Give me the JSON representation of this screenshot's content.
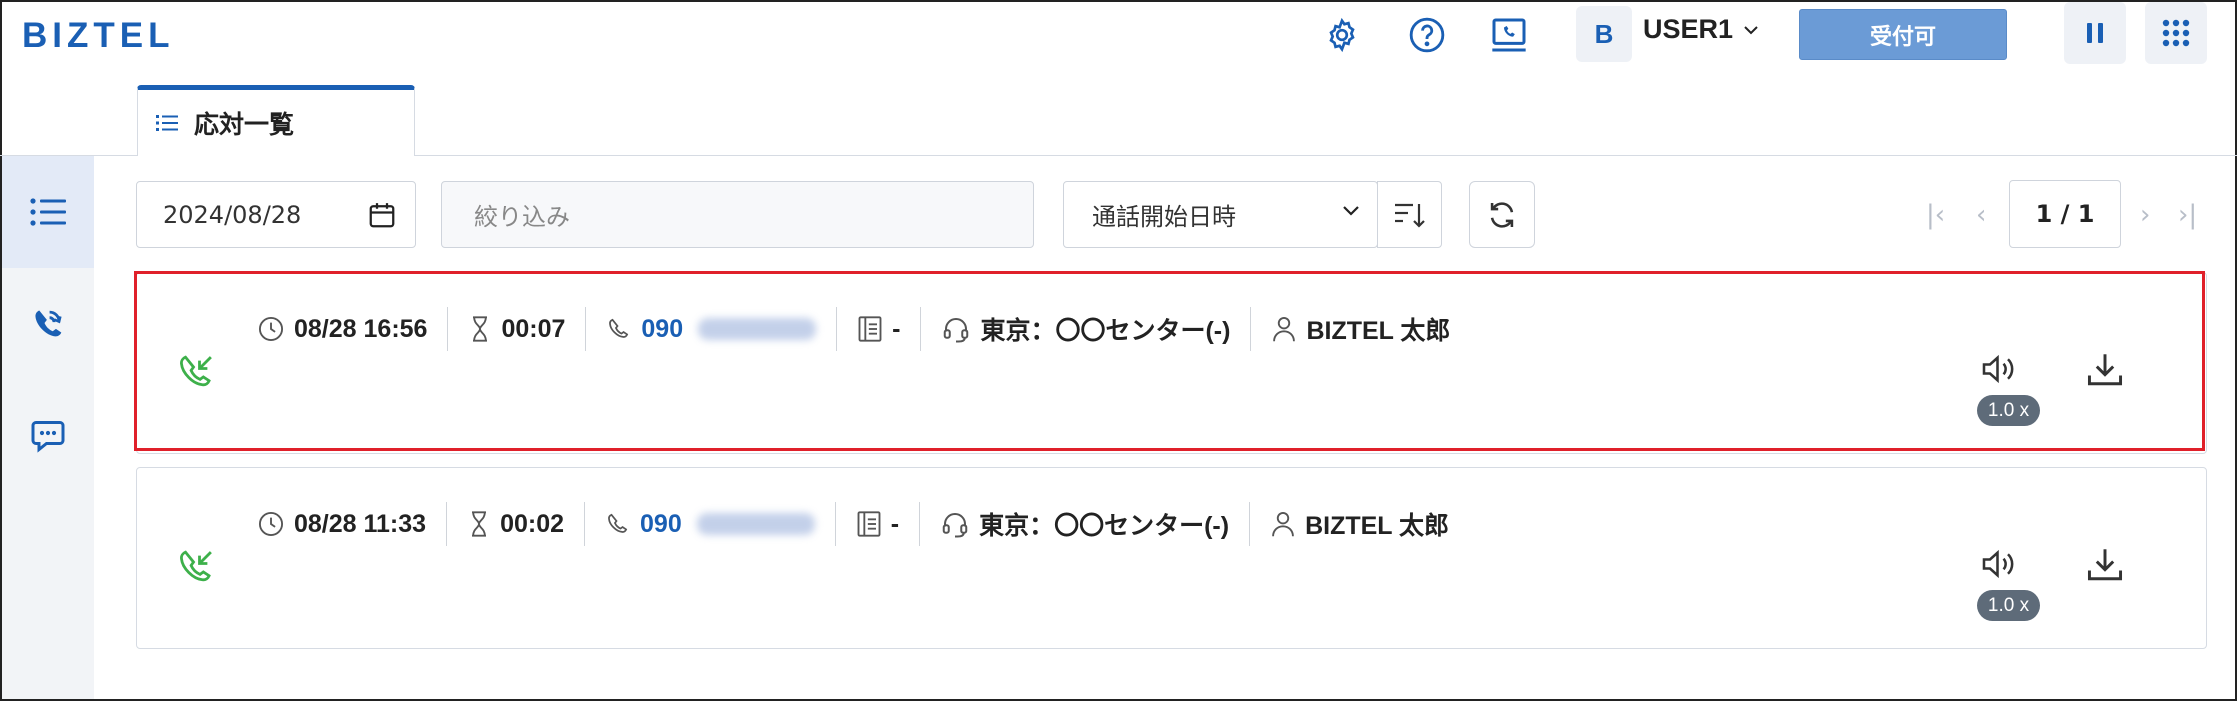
{
  "app": {
    "logo": "BIZTEL"
  },
  "header": {
    "avatar_initial": "B",
    "user_name": "USER1",
    "status_button": "受付可"
  },
  "tab": {
    "label": "応対一覧"
  },
  "toolbar": {
    "date": "2024/08/28",
    "filter_placeholder": "絞り込み",
    "sort_field": "通話開始日時",
    "page_indicator": "1 / 1",
    "page_first": "|‹",
    "page_prev": "‹",
    "page_next": "›",
    "page_last": "›|"
  },
  "records": [
    {
      "datetime": "08/28 16:56",
      "duration": "00:07",
      "phone_prefix": "090",
      "memo": "-",
      "queue": "東京：〇〇センター(-)",
      "agent": "BIZTEL 太郎",
      "speed": "1.0 x"
    },
    {
      "datetime": "08/28 11:33",
      "duration": "00:02",
      "phone_prefix": "090",
      "memo": "-",
      "queue": "東京：〇〇センター(-)",
      "agent": "BIZTEL 太郎",
      "speed": "1.0 x"
    }
  ],
  "colors": {
    "brand": "#1a5fb4",
    "status_button": "#6b9bd6",
    "incoming_call": "#3db04a",
    "highlight": "#e0202a"
  }
}
